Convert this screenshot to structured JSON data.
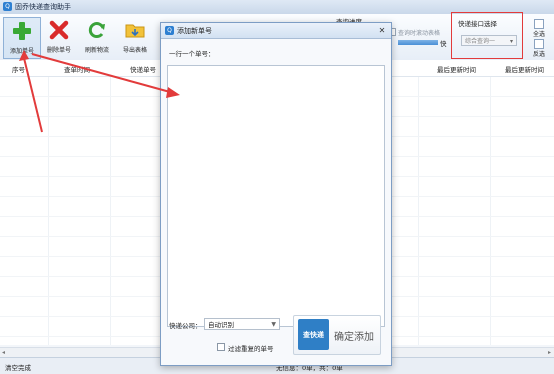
{
  "window": {
    "title": "固乔快递查询助手"
  },
  "toolbar": {
    "items": [
      {
        "label": "添加单号",
        "icon": "plus-icon"
      },
      {
        "label": "删除单号",
        "icon": "delete-x-icon"
      },
      {
        "label": "刷新物流",
        "icon": "refresh-icon"
      },
      {
        "label": "导出表格",
        "icon": "folder-export-icon"
      }
    ]
  },
  "query": {
    "progress_label": "查询进度",
    "scroll_label": "查询时滚动表格",
    "speed_label": "快"
  },
  "interface_panel": {
    "title": "快递接口选择",
    "selected": "综合查询一"
  },
  "side": {
    "select_all": "全选",
    "invert": "反选"
  },
  "table": {
    "columns": [
      "序号",
      "查单时间",
      "快递单号",
      "最后更新时间",
      "最后更新时间"
    ]
  },
  "dialog": {
    "title": "添加新单号",
    "close": "✕",
    "instruction": "一行一个单号：",
    "textarea_value": "",
    "company_label": "快递公司：",
    "company_value": "自动识别",
    "filter_label": "过滤重复的单号",
    "logo_text": "查快递",
    "confirm_label": "确定添加"
  },
  "status": {
    "left": "清空完成",
    "middle": "无信息：0单，共：0单"
  },
  "colors": {
    "accent": "#2f7fc6",
    "annotation": "#e23b3b"
  }
}
